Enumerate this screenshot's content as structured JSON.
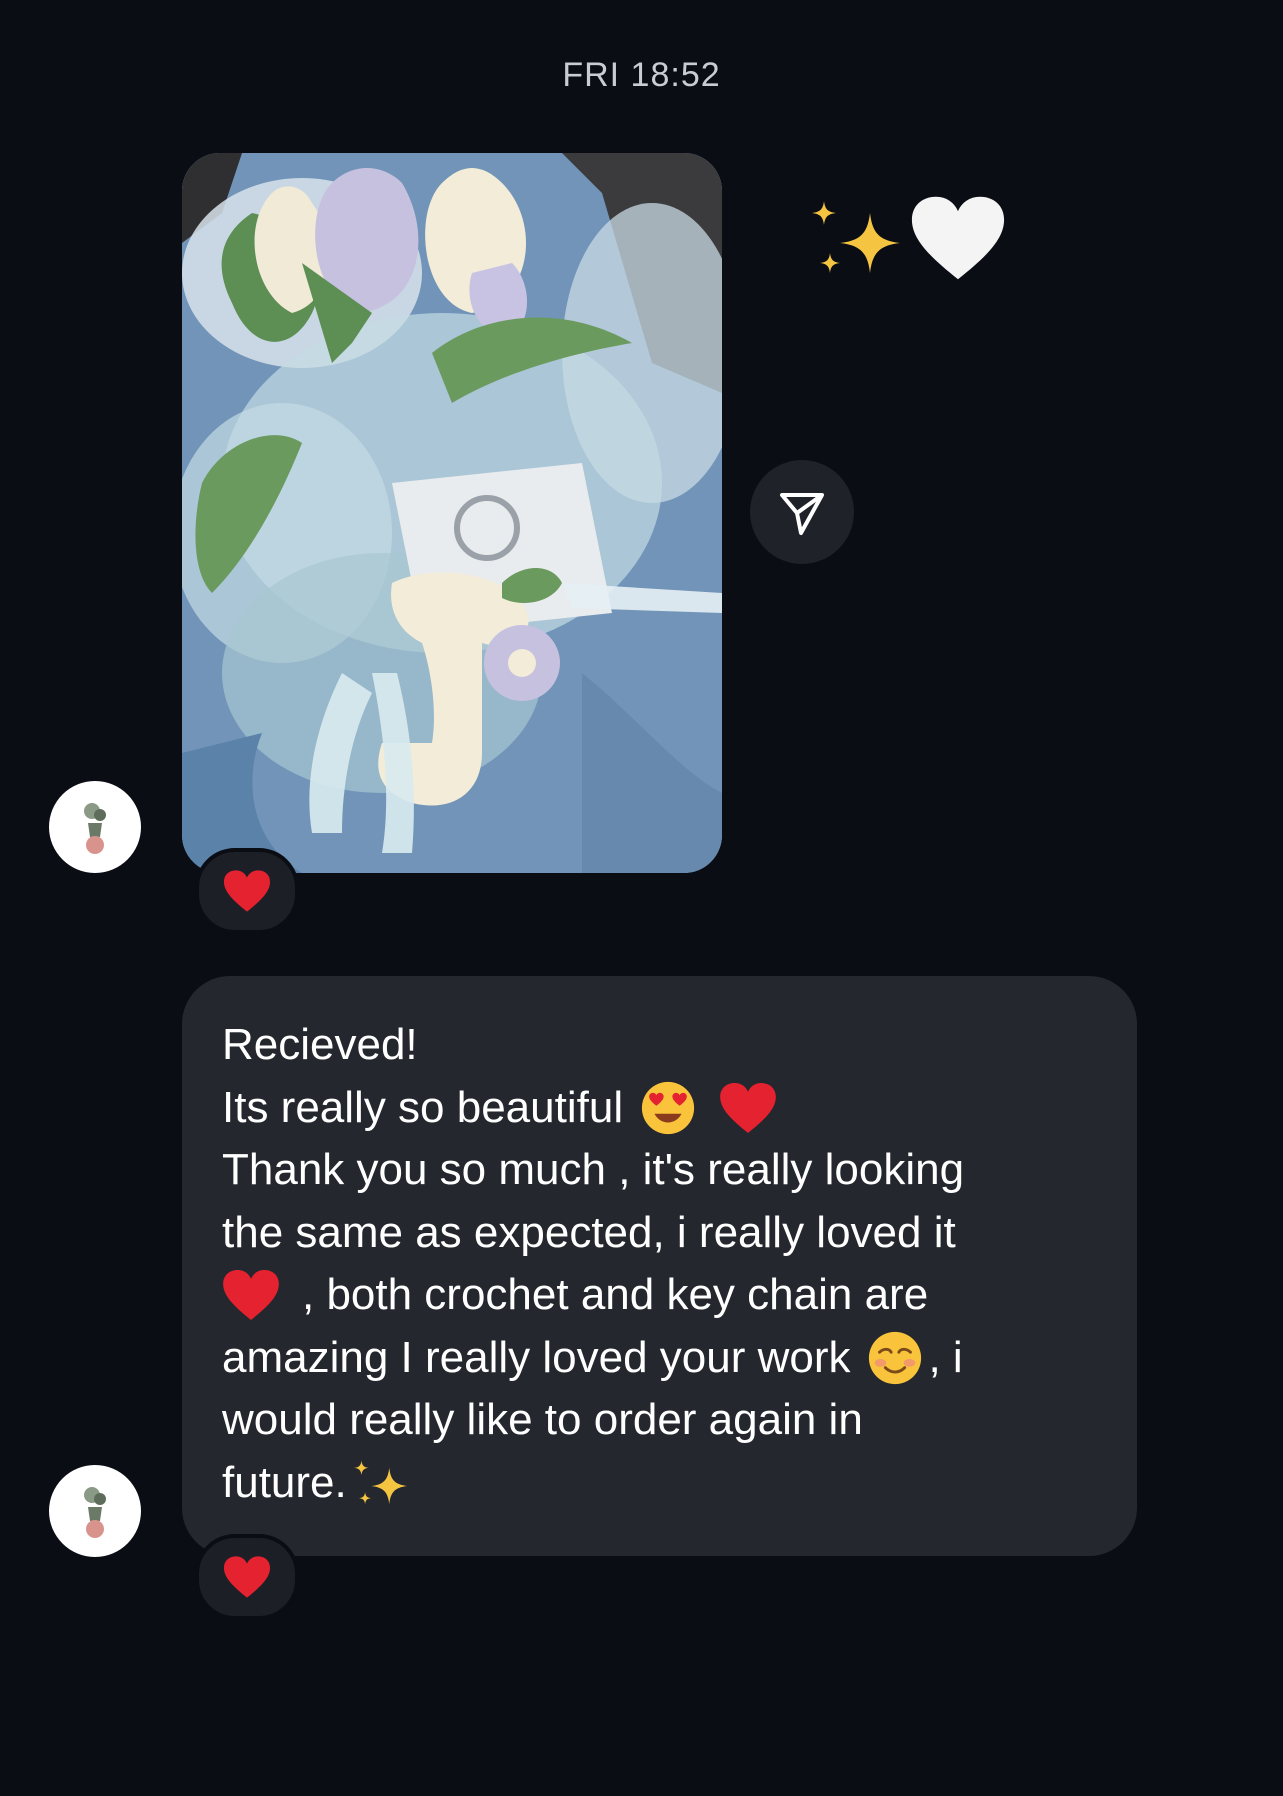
{
  "thread": {
    "timestamp": "FRI 18:52"
  },
  "photo_message": {
    "image_description_icon": "crochet-bouquet-photo",
    "sent_reply_emojis": [
      "sparkles-icon",
      "white-heart-icon"
    ],
    "share_icon": "paper-plane-icon",
    "reaction": "red-heart-icon"
  },
  "text_message": {
    "lines": [
      "Recieved!",
      "Its really so beautiful",
      "Thank you so much , it's really looking",
      "the same as expected, i really loved it",
      ", both crochet and key chain are",
      "amazing I really loved your work",
      ", i",
      "would really like to order again in",
      "future."
    ],
    "reaction": "red-heart-icon"
  },
  "colors": {
    "background": "#0a0d14",
    "bubble": "#24272d",
    "reaction_pill": "#1c1f26",
    "text": "#ffffff",
    "timestamp": "#c9ccd2",
    "heart_red": "#e5222f"
  }
}
